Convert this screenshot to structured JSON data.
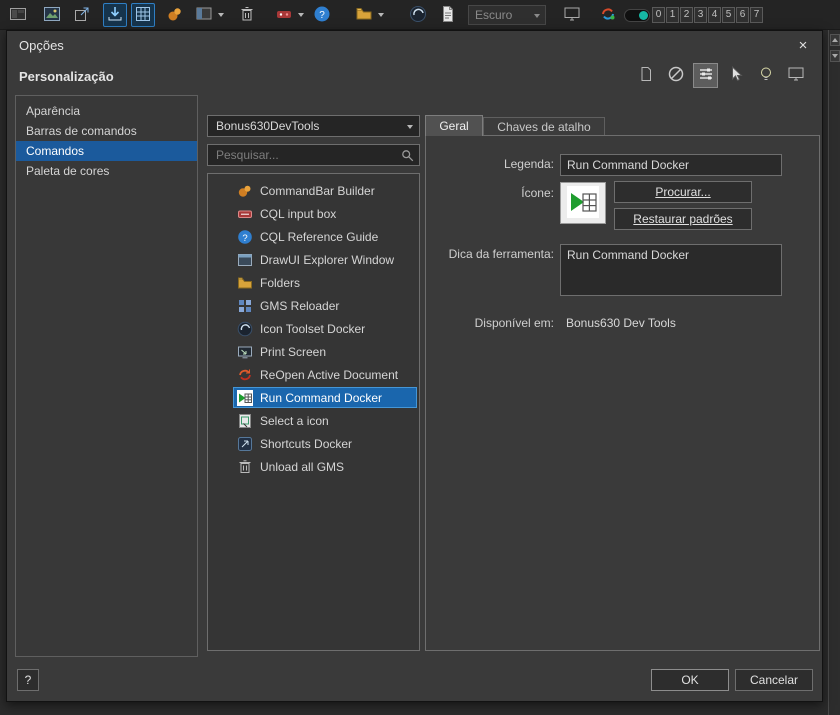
{
  "toolbar": {
    "theme_select_value": "Escuro",
    "profile_numbers": [
      "0",
      "1",
      "2",
      "3",
      "4",
      "5",
      "6",
      "7"
    ]
  },
  "dialog": {
    "title": "Opções",
    "close_glyph": "×",
    "section_title": "Personalização",
    "sidebar": {
      "items": [
        {
          "label": "Aparência"
        },
        {
          "label": "Barras de comandos"
        },
        {
          "label": "Comandos"
        },
        {
          "label": "Paleta de cores"
        }
      ]
    },
    "commands_panel": {
      "category_value": "Bonus630DevTools",
      "search_placeholder": "Pesquisar...",
      "items": [
        {
          "label": "CommandBar Builder"
        },
        {
          "label": "CQL input box"
        },
        {
          "label": "CQL Reference Guide"
        },
        {
          "label": "DrawUI Explorer Window"
        },
        {
          "label": "Folders"
        },
        {
          "label": "GMS Reloader"
        },
        {
          "label": "Icon Toolset Docker"
        },
        {
          "label": "Print Screen"
        },
        {
          "label": "ReOpen Active Document"
        },
        {
          "label": "Run Command Docker"
        },
        {
          "label": "Select a icon"
        },
        {
          "label": "Shortcuts Docker"
        },
        {
          "label": "Unload all GMS"
        }
      ]
    },
    "detail_panel": {
      "tabs": [
        {
          "label": "Geral"
        },
        {
          "label": "Chaves de atalho"
        }
      ],
      "legend_label": "Legenda:",
      "legend_value": "Run Command Docker",
      "icon_label": "Ícone:",
      "browse_button": "Procurar...",
      "restore_button": "Restaurar padrões",
      "tooltip_label": "Dica da ferramenta:",
      "tooltip_value": "Run Command Docker",
      "available_label": "Disponível em:",
      "available_value": "Bonus630 Dev Tools"
    },
    "footer": {
      "help_button": "?",
      "ok_button": "OK",
      "cancel_button": "Cancelar"
    }
  },
  "colors": {
    "selection_blue": "#1a66ad",
    "selection_border": "#4596d6",
    "sidebar_selection": "#1b5a9c",
    "toggle_teal": "#16b8a4",
    "active_tool_border": "#2f7fc4"
  }
}
